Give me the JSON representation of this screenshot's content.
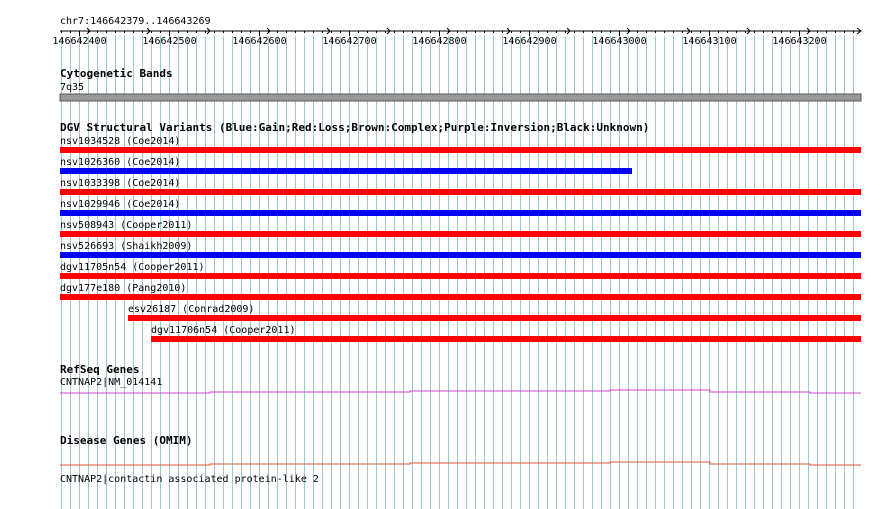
{
  "region": {
    "label": "chr7:146642379..146643269"
  },
  "ruler": {
    "ticks": [
      "146642400",
      "146642500",
      "146642600",
      "146642700",
      "146642800",
      "146642900",
      "146643000",
      "146643100",
      "146643200"
    ]
  },
  "tracks": {
    "cytoband": {
      "title": "Cytogenetic Bands",
      "band": "7q35"
    },
    "dgv": {
      "title": "DGV Structural Variants (Blue:Gain;Red:Loss;Brown:Complex;Purple:Inversion;Black:Unknown)",
      "colors": {
        "gain": "#0000ee",
        "loss": "#ff0000",
        "complex": "#8b4513",
        "inversion": "#800080",
        "unknown": "#000000"
      },
      "variants": [
        {
          "label": "nsv1034528 (Coe2014)",
          "type": "loss",
          "start": 146642379,
          "end": 146643269
        },
        {
          "label": "nsv1026360 (Coe2014)",
          "type": "gain",
          "start": 146642379,
          "end": 146643015
        },
        {
          "label": "nsv1033398 (Coe2014)",
          "type": "loss",
          "start": 146642379,
          "end": 146643269
        },
        {
          "label": "nsv1029946 (Coe2014)",
          "type": "gain",
          "start": 146642379,
          "end": 146643269
        },
        {
          "label": "nsv508943 (Cooper2011)",
          "type": "loss",
          "start": 146642379,
          "end": 146643269
        },
        {
          "label": "nsv526693 (Shaikh2009)",
          "type": "gain",
          "start": 146642379,
          "end": 146643269
        },
        {
          "label": "dgv11705n54 (Cooper2011)",
          "type": "loss",
          "start": 146642379,
          "end": 146643269
        },
        {
          "label": "dgv177e180 (Pang2010)",
          "type": "loss",
          "start": 146642379,
          "end": 146643269
        },
        {
          "label": "esv26187 (Conrad2009)",
          "type": "loss",
          "start": 146642455,
          "end": 146643269
        },
        {
          "label": "dgv11706n54 (Cooper2011)",
          "type": "loss",
          "start": 146642480,
          "end": 146643269
        }
      ]
    },
    "refseq": {
      "title": "RefSeq Genes",
      "gene": "CNTNAP2|NM_014141",
      "color": "#cc44cc"
    },
    "omim": {
      "title": "Disease Genes (OMIM)",
      "gene": "CNTNAP2|contactin associated protein-like 2",
      "color": "#dd5533"
    }
  }
}
